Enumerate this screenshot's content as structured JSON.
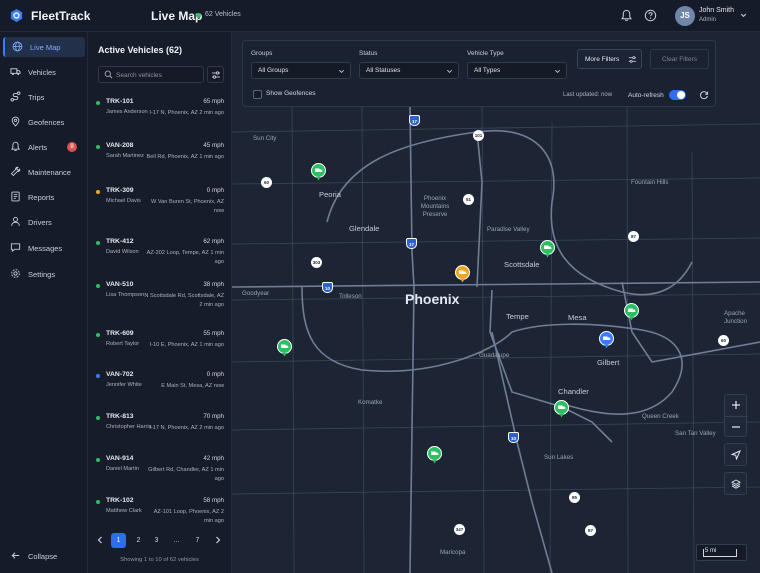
{
  "app": {
    "name": "FleetTrack"
  },
  "header": {
    "page_title": "Live Map",
    "vehicle_count": "62 Vehicles",
    "user": {
      "initials": "JS",
      "name": "John Smith",
      "role": "Admin"
    }
  },
  "sidebar": {
    "items": [
      {
        "label": "Live Map",
        "icon": "globe-icon",
        "active": true
      },
      {
        "label": "Vehicles",
        "icon": "truck-icon"
      },
      {
        "label": "Trips",
        "icon": "route-icon"
      },
      {
        "label": "Geofences",
        "icon": "geofence-icon"
      },
      {
        "label": "Alerts",
        "icon": "bell-icon",
        "badge": "8"
      },
      {
        "label": "Maintenance",
        "icon": "wrench-icon"
      },
      {
        "label": "Reports",
        "icon": "report-icon"
      },
      {
        "label": "Drivers",
        "icon": "driver-icon"
      },
      {
        "label": "Messages",
        "icon": "message-icon"
      },
      {
        "label": "Settings",
        "icon": "gear-icon"
      }
    ],
    "collapse_label": "Collapse"
  },
  "vehicle_panel": {
    "title": "Active Vehicles (62)",
    "search_placeholder": "Search vehicles",
    "vehicles": [
      {
        "id": "TRK-101",
        "driver": "James Anderson",
        "speed": "65 mph",
        "location": "I-17 N, Phoenix, AZ",
        "updated": "2 min ago",
        "status": "moving"
      },
      {
        "id": "VAN-208",
        "driver": "Sarah Martinez",
        "speed": "45 mph",
        "location": "Bell Rd, Phoenix, AZ",
        "updated": "1 min ago",
        "status": "moving"
      },
      {
        "id": "TRK-309",
        "driver": "Michael Davis",
        "speed": "0 mph",
        "location": "W Van Buren St, Phoenix, AZ",
        "updated": "now",
        "status": "idle"
      },
      {
        "id": "TRK-412",
        "driver": "David Wilson",
        "speed": "62 mph",
        "location": "AZ-202 Loop, Tempe, AZ",
        "updated": "1 min ago",
        "status": "moving"
      },
      {
        "id": "VAN-510",
        "driver": "Lisa Thompson",
        "speed": "38 mph",
        "location": "N Scottsdale Rd, Scottsdale, AZ",
        "updated": "2 min ago",
        "status": "moving"
      },
      {
        "id": "TRK-609",
        "driver": "Robert Taylor",
        "speed": "55 mph",
        "location": "I-10 E, Phoenix, AZ",
        "updated": "1 min ago",
        "status": "moving"
      },
      {
        "id": "VAN-702",
        "driver": "Jennifer White",
        "speed": "0 mph",
        "location": "E Main St, Mesa, AZ",
        "updated": "now",
        "status": "stopped"
      },
      {
        "id": "TRK-813",
        "driver": "Christopher Harris",
        "speed": "70 mph",
        "location": "I-17 N, Phoenix, AZ",
        "updated": "2 min ago",
        "status": "moving"
      },
      {
        "id": "VAN-914",
        "driver": "Daniel Martin",
        "speed": "42 mph",
        "location": "Gilbert Rd, Chandler, AZ",
        "updated": "1 min ago",
        "status": "moving"
      },
      {
        "id": "TRK-102",
        "driver": "Matthew Clark",
        "speed": "58 mph",
        "location": "AZ-101 Loop, Phoenix, AZ",
        "updated": "2 min ago",
        "status": "moving"
      }
    ],
    "pagination": {
      "pages": [
        "1",
        "2",
        "3",
        "...",
        "7"
      ],
      "current": "1",
      "showing": "Showing 1 to 10 of 62 vehicles"
    }
  },
  "filters": {
    "groups": {
      "label": "Groups",
      "value": "All Groups"
    },
    "status": {
      "label": "Status",
      "value": "All Statuses"
    },
    "vehicle_type": {
      "label": "Vehicle Type",
      "value": "All Types"
    },
    "more_filters_label": "More Filters",
    "clear_filters_label": "Clear Filters",
    "show_geofences_label": "Show Geofences",
    "last_updated": "Last updated: now",
    "auto_refresh_label": "Auto-refresh",
    "auto_refresh_on": true
  },
  "map": {
    "places": {
      "sun_city": "Sun City",
      "peoria": "Peoria",
      "glendale": "Glendale",
      "phoenix": "Phoenix",
      "preserve": "Phoenix Mountains Preserve",
      "paradise_valley": "Paradise Valley",
      "scottsdale": "Scottsdale",
      "fountain_hills": "Fountain Hills",
      "goodyear": "Goodyear",
      "tolleson": "Tolleson",
      "tempe": "Tempe",
      "mesa": "Mesa",
      "apache_junction": "Apache Junction",
      "guadalupe": "Guadalupe",
      "gilbert": "Gilbert",
      "chandler": "Chandler",
      "komatke": "Komatke",
      "queen_creek": "Queen Creek",
      "san_tan_valley": "San Tan Valley",
      "sun_lakes": "Sun Lakes",
      "maricopa": "Maricopa"
    },
    "routes": {
      "r17a": "17",
      "r101": "101",
      "r60a": "60",
      "r51": "51",
      "r17b": "17",
      "r87": "87",
      "r303": "303",
      "r10": "10",
      "r60b": "60",
      "r10b": "10",
      "r85": "85",
      "r347": "347",
      "r87b": "87"
    },
    "scale_label": "5 mi",
    "colors": {
      "moving": "#2fbf62",
      "idle": "#f0a623",
      "stopped": "#3a7bff"
    }
  }
}
